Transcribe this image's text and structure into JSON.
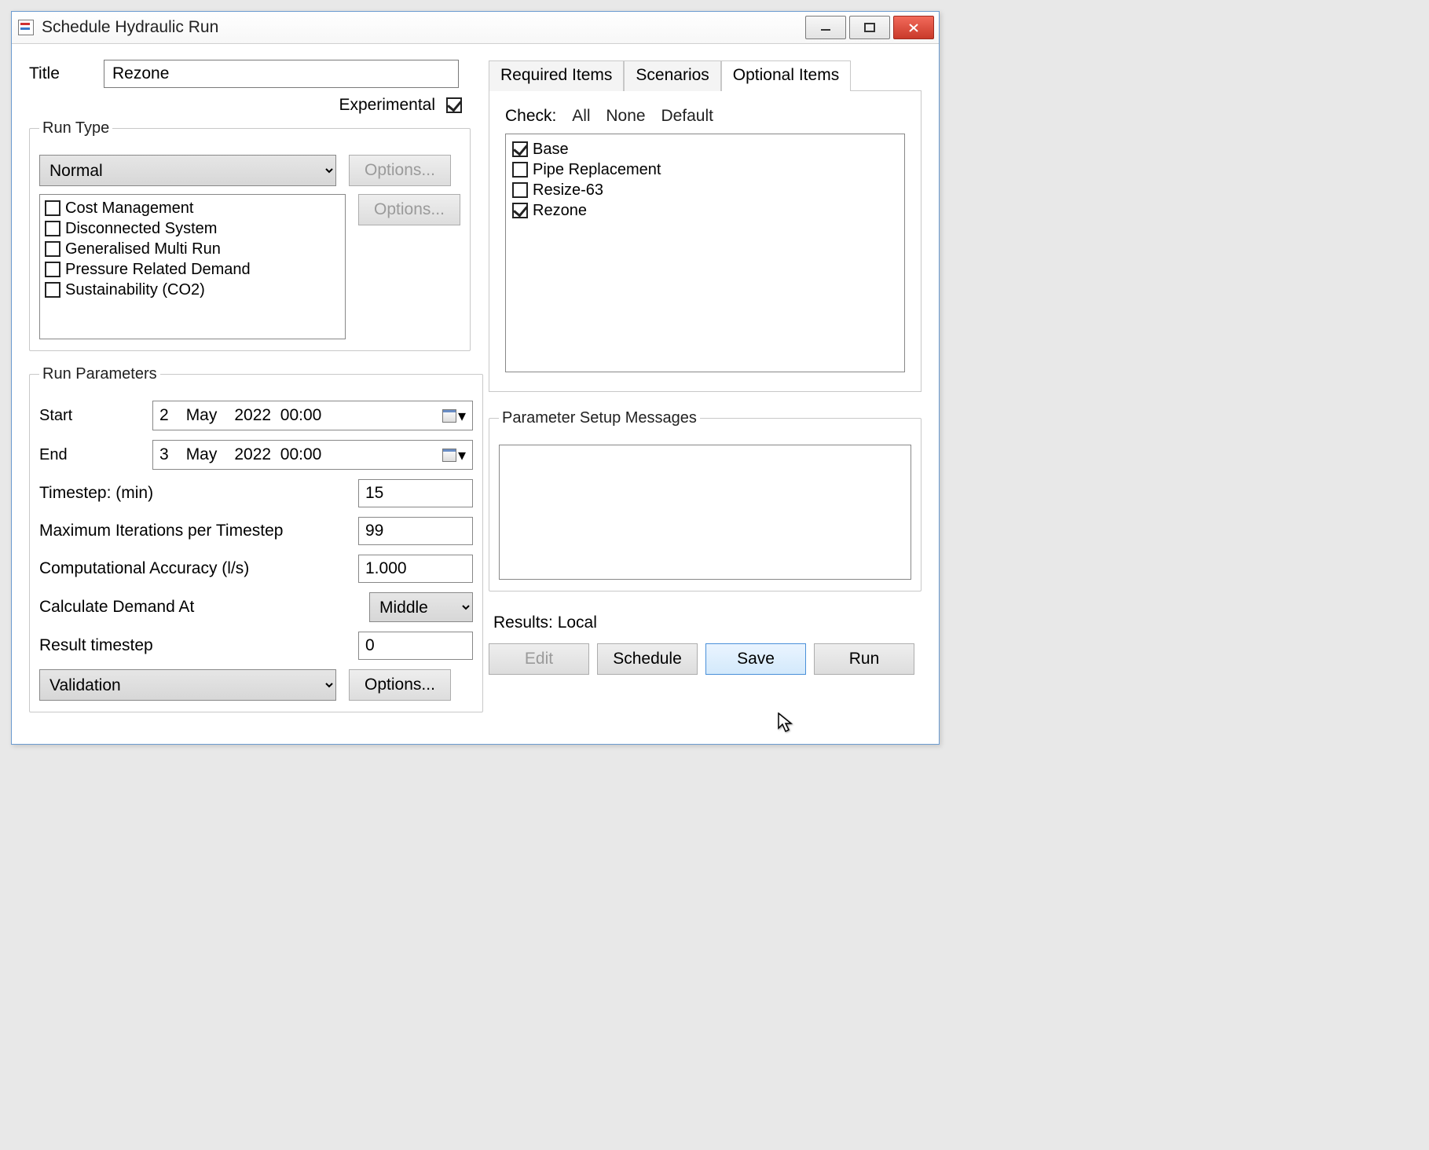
{
  "window": {
    "title": "Schedule Hydraulic Run"
  },
  "form": {
    "title_label": "Title",
    "title_value": "Rezone",
    "experimental_label": "Experimental",
    "experimental_checked": true
  },
  "run_type": {
    "legend": "Run Type",
    "selected": "Normal",
    "options_btn": "Options...",
    "options_btn2": "Options...",
    "items": [
      {
        "label": "Cost Management",
        "checked": false
      },
      {
        "label": "Disconnected System",
        "checked": false
      },
      {
        "label": "Generalised Multi Run",
        "checked": false
      },
      {
        "label": "Pressure Related Demand",
        "checked": false
      },
      {
        "label": "Sustainability (CO2)",
        "checked": false
      }
    ]
  },
  "run_params": {
    "legend": "Run Parameters",
    "start_label": "Start",
    "start_value": {
      "day": "2",
      "month": "May",
      "year": "2022",
      "time": "00:00"
    },
    "end_label": "End",
    "end_value": {
      "day": "3",
      "month": "May",
      "year": "2022",
      "time": "00:00"
    },
    "timestep_label": "Timestep: (min)",
    "timestep_value": "15",
    "maxiter_label": "Maximum Iterations per Timestep",
    "maxiter_value": "99",
    "accuracy_label": "Computational Accuracy (l/s)",
    "accuracy_value": "1.000",
    "demand_label": "Calculate Demand At",
    "demand_value": "Middle",
    "result_ts_label": "Result timestep",
    "result_ts_value": "0",
    "validation_value": "Validation",
    "validation_options_btn": "Options..."
  },
  "tabs": {
    "required": "Required Items",
    "scenarios": "Scenarios",
    "optional": "Optional Items",
    "active": "optional"
  },
  "optional": {
    "check_label": "Check:",
    "all": "All",
    "none": "None",
    "default": "Default",
    "items": [
      {
        "label": "Base",
        "checked": true
      },
      {
        "label": "Pipe Replacement",
        "checked": false
      },
      {
        "label": "Resize-63",
        "checked": false
      },
      {
        "label": "Rezone",
        "checked": true
      }
    ]
  },
  "messages": {
    "legend": "Parameter Setup Messages"
  },
  "results": {
    "label": "Results: Local"
  },
  "actions": {
    "edit": "Edit",
    "schedule": "Schedule",
    "save": "Save",
    "run": "Run"
  }
}
